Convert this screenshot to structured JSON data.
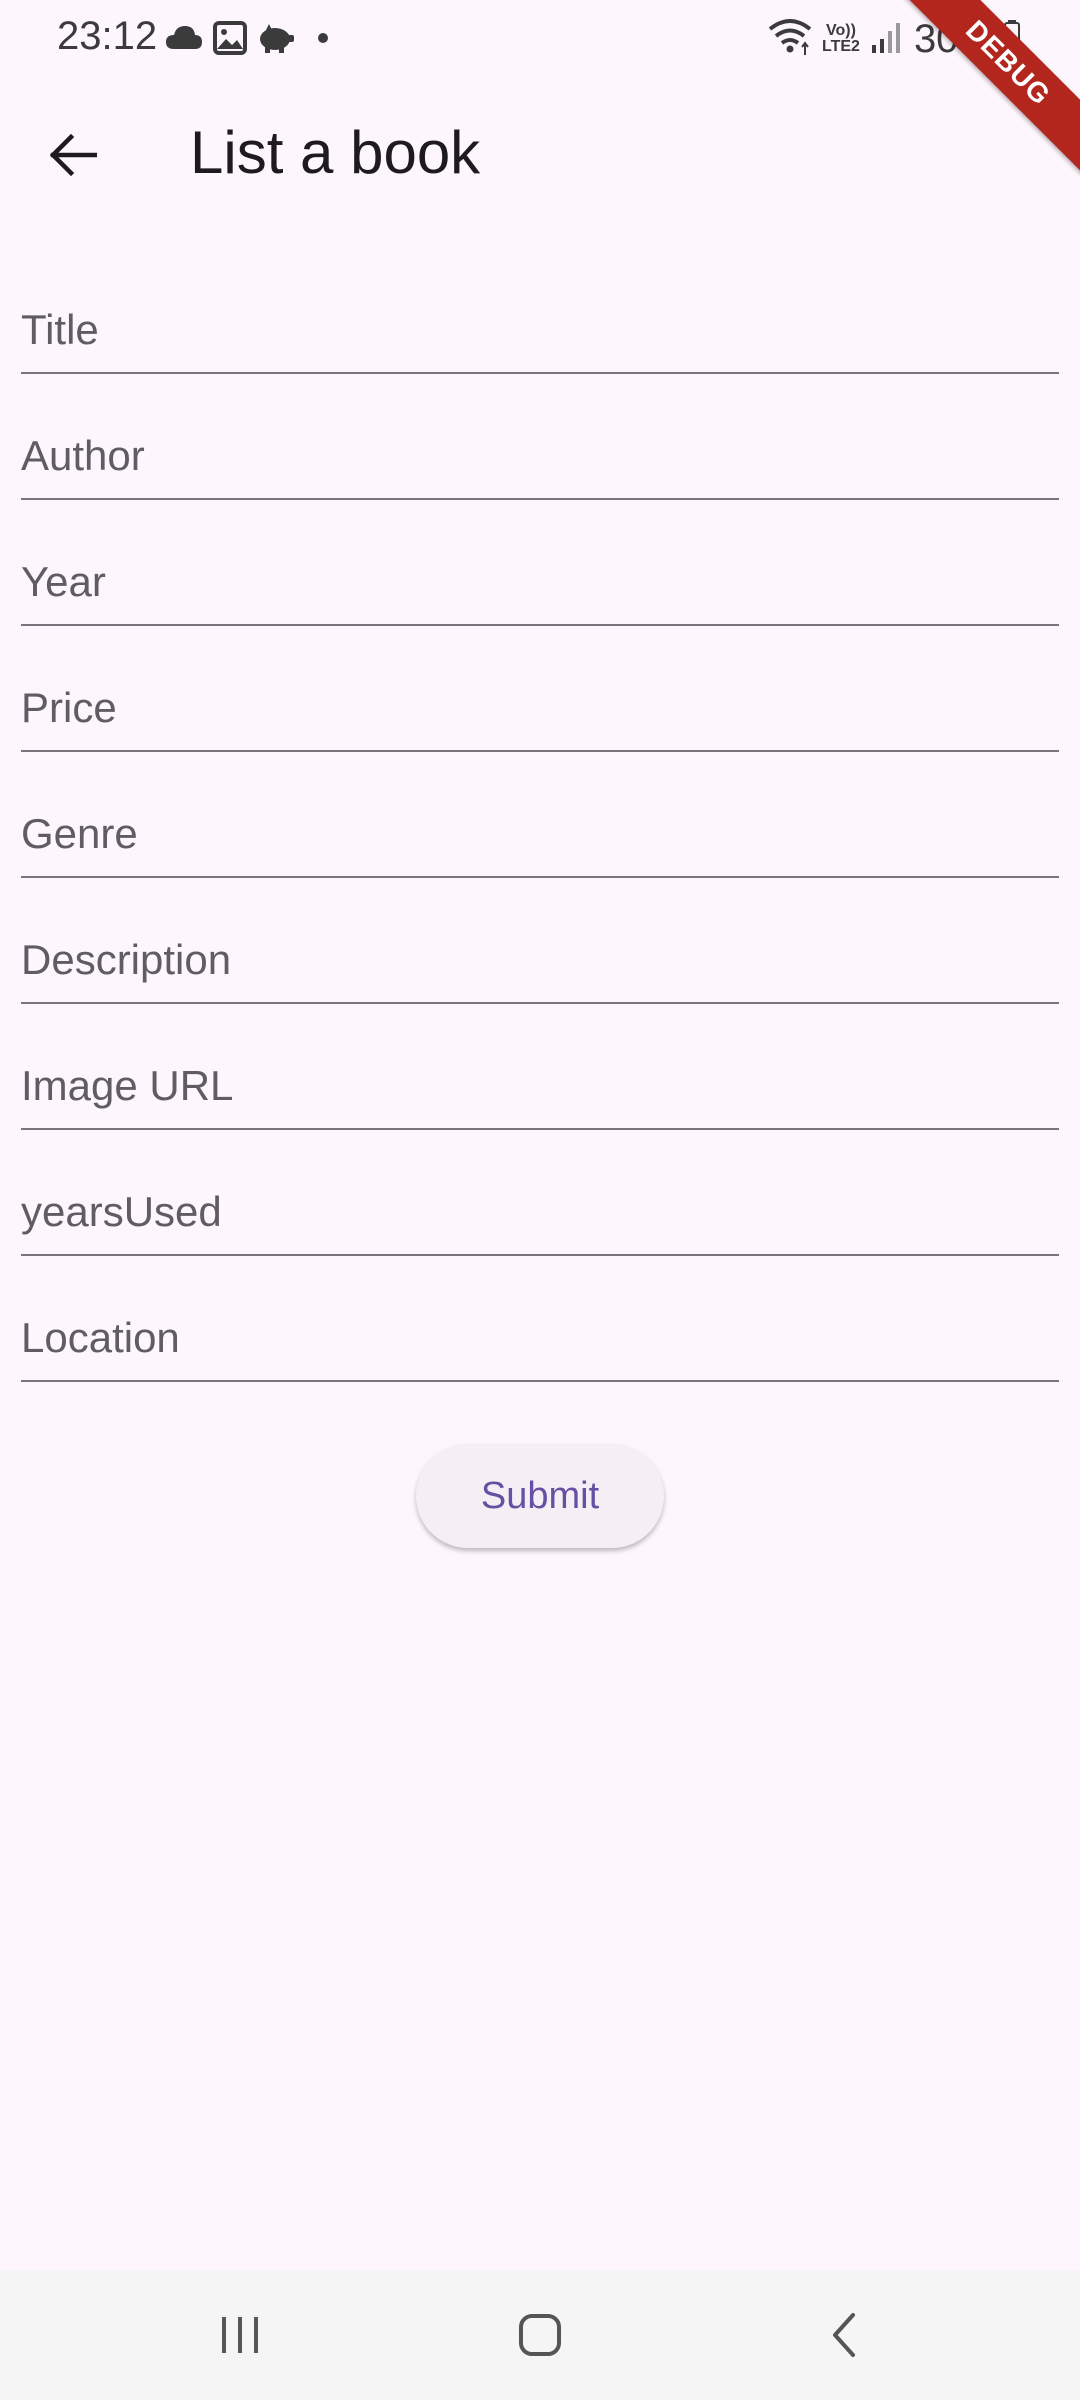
{
  "status_bar": {
    "time": "23:12",
    "battery": "30%",
    "network": {
      "volte": "Vo))",
      "lte": "LTE2"
    },
    "icons": [
      "cloud-icon",
      "gallery-icon",
      "piggy-bank-icon",
      "dot-icon",
      "wifi-icon",
      "signal-icon",
      "battery-icon"
    ]
  },
  "debug_banner": "DEBUG",
  "app_bar": {
    "title": "List a book",
    "back_icon": "arrow-left-icon"
  },
  "form": {
    "fields": [
      {
        "name": "title",
        "placeholder": "Title",
        "value": ""
      },
      {
        "name": "author",
        "placeholder": "Author",
        "value": ""
      },
      {
        "name": "year",
        "placeholder": "Year",
        "value": ""
      },
      {
        "name": "price",
        "placeholder": "Price",
        "value": ""
      },
      {
        "name": "genre",
        "placeholder": "Genre",
        "value": ""
      },
      {
        "name": "description",
        "placeholder": "Description",
        "value": ""
      },
      {
        "name": "image-url",
        "placeholder": "Image URL",
        "value": ""
      },
      {
        "name": "years-used",
        "placeholder": "yearsUsed",
        "value": ""
      },
      {
        "name": "location",
        "placeholder": "Location",
        "value": ""
      }
    ],
    "submit_label": "Submit"
  },
  "nav_bar": {
    "icons": [
      "recent-apps-icon",
      "home-icon",
      "back-icon"
    ]
  },
  "colors": {
    "background": "#FDF7FD",
    "accent": "#6750A4",
    "debug_banner": "#B3261E",
    "underline": "#79747E"
  }
}
